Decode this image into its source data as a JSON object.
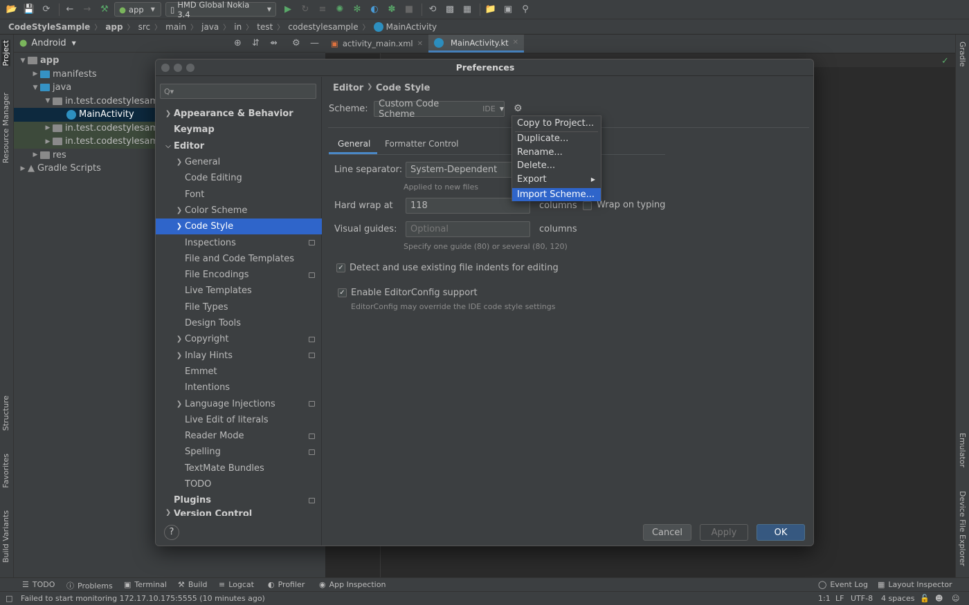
{
  "toolbar": {
    "run_config": "app",
    "device": "HMD Global Nokia 3.4"
  },
  "breadcrumb": [
    "CodeStyleSample",
    "app",
    "src",
    "main",
    "java",
    "in",
    "test",
    "codestylesample",
    "MainActivity"
  ],
  "left_strip": {
    "project": "Project",
    "resource_manager": "Resource Manager",
    "structure": "Structure",
    "favorites": "Favorites",
    "build_variants": "Build Variants"
  },
  "right_strip": {
    "gradle": "Gradle",
    "emulator": "Emulator",
    "device_file_explorer": "Device File Explorer"
  },
  "project_panel": {
    "view": "Android",
    "tree": [
      {
        "label": "app"
      },
      {
        "label": "manifests"
      },
      {
        "label": "java"
      },
      {
        "label": "in.test.codestylesam"
      },
      {
        "label": "MainActivity"
      },
      {
        "label": "in.test.codestylesam"
      },
      {
        "label": "in.test.codestylesam"
      },
      {
        "label": "res"
      },
      {
        "label": "Gradle Scripts"
      }
    ]
  },
  "editor": {
    "tabs": [
      {
        "label": "activity_main.xml"
      },
      {
        "label": "MainActivity.kt"
      }
    ]
  },
  "dialog": {
    "title": "Preferences",
    "search_placeholder": "Q▾",
    "nav": [
      {
        "label": "Appearance & Behavior"
      },
      {
        "label": "Keymap"
      },
      {
        "label": "Editor"
      },
      {
        "label": "General"
      },
      {
        "label": "Code Editing"
      },
      {
        "label": "Font"
      },
      {
        "label": "Color Scheme"
      },
      {
        "label": "Code Style"
      },
      {
        "label": "Inspections"
      },
      {
        "label": "File and Code Templates"
      },
      {
        "label": "File Encodings"
      },
      {
        "label": "Live Templates"
      },
      {
        "label": "File Types"
      },
      {
        "label": "Design Tools"
      },
      {
        "label": "Copyright"
      },
      {
        "label": "Inlay Hints"
      },
      {
        "label": "Emmet"
      },
      {
        "label": "Intentions"
      },
      {
        "label": "Language Injections"
      },
      {
        "label": "Live Edit of literals"
      },
      {
        "label": "Reader Mode"
      },
      {
        "label": "Spelling"
      },
      {
        "label": "TextMate Bundles"
      },
      {
        "label": "TODO"
      },
      {
        "label": "Plugins"
      },
      {
        "label": "Version Control"
      }
    ],
    "path": {
      "parent": "Editor",
      "current": "Code Style"
    },
    "scheme_label": "Scheme:",
    "scheme_value": "Custom Code Scheme",
    "scheme_suffix": "IDE",
    "tabs": [
      "General",
      "Formatter Control"
    ],
    "line_separator_label": "Line separator:",
    "line_separator_value": "System-Dependent",
    "line_separator_hint": "Applied to new files",
    "hard_wrap_label": "Hard wrap at",
    "hard_wrap_value": "118",
    "hard_wrap_unit": "columns",
    "wrap_on_typing": "Wrap on typing",
    "visual_guides_label": "Visual guides:",
    "visual_guides_placeholder": "Optional",
    "visual_guides_unit": "columns",
    "visual_guides_hint": "Specify one guide (80) or several (80, 120)",
    "detect_indents": "Detect and use existing file indents for editing",
    "editorconfig": "Enable EditorConfig support",
    "editorconfig_hint": "EditorConfig may override the IDE code style settings",
    "buttons": {
      "cancel": "Cancel",
      "apply": "Apply",
      "ok": "OK"
    },
    "help": "?"
  },
  "menu": {
    "items": [
      {
        "label": "Copy to Project..."
      },
      {
        "label": "Duplicate..."
      },
      {
        "label": "Rename..."
      },
      {
        "label": "Delete..."
      },
      {
        "label": "Export"
      },
      {
        "label": "Import Scheme..."
      }
    ]
  },
  "bottom_bar": {
    "todo": "TODO",
    "problems": "Problems",
    "terminal": "Terminal",
    "build": "Build",
    "logcat": "Logcat",
    "profiler": "Profiler",
    "app_inspection": "App Inspection",
    "event_log": "Event Log",
    "layout_inspector": "Layout Inspector"
  },
  "status_bar": {
    "message": "Failed to start monitoring 172.17.10.175:5555 (10 minutes ago)",
    "position": "1:1",
    "line_ending": "LF",
    "encoding": "UTF-8",
    "indent": "4 spaces"
  }
}
